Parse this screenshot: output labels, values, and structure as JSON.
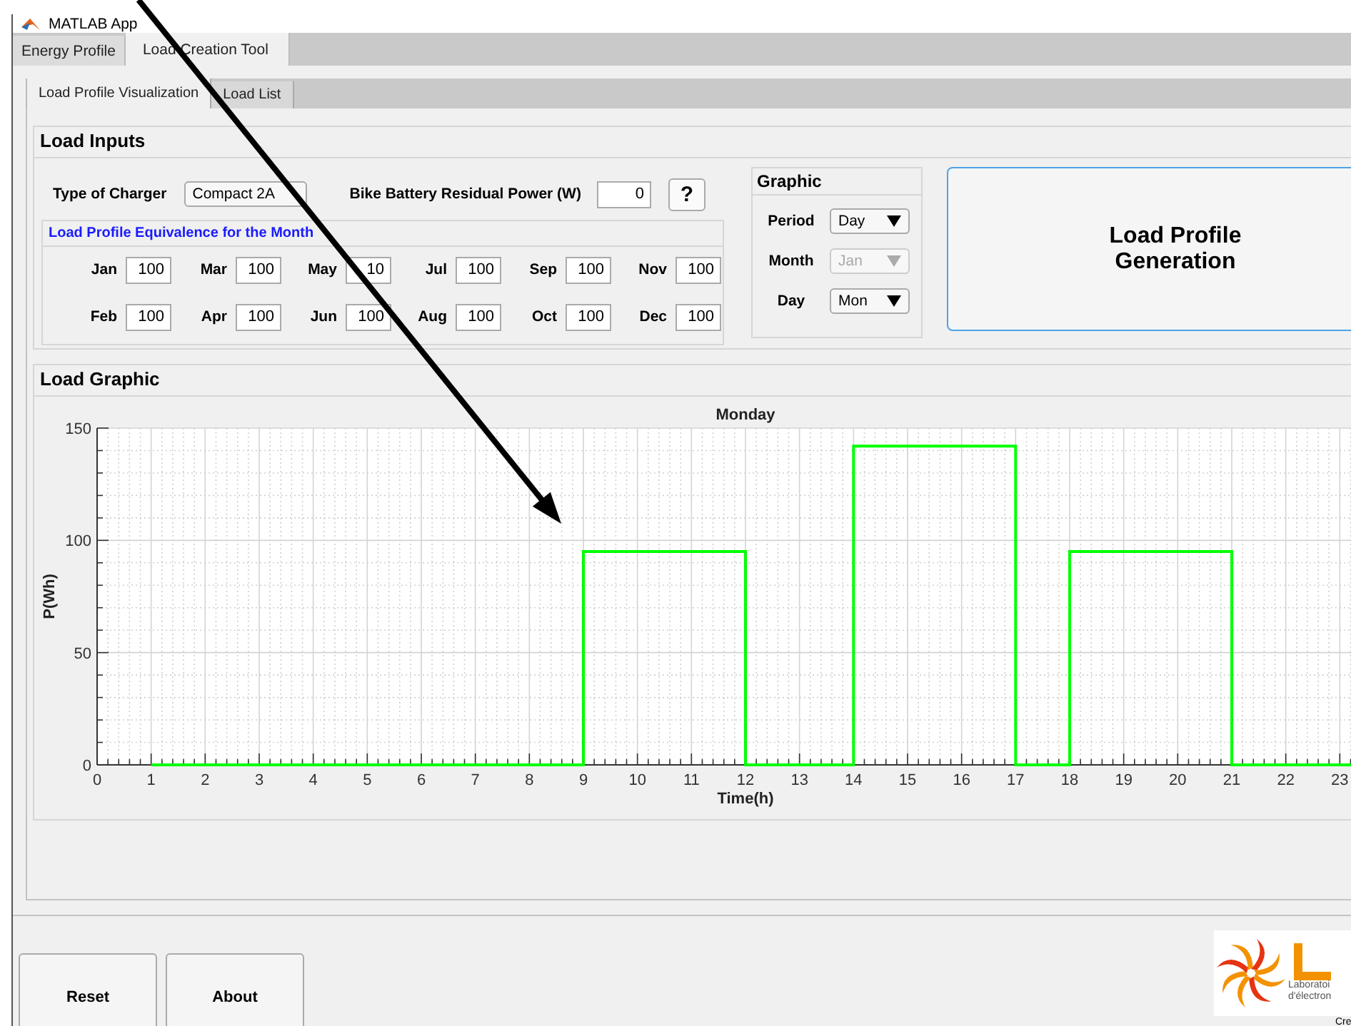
{
  "window": {
    "title": "MATLAB App"
  },
  "tabs": [
    {
      "label": "Energy Profile",
      "selected": false
    },
    {
      "label": "Load Creation Tool",
      "selected": true
    }
  ],
  "subtabs": [
    {
      "label": "Load Profile Visualization",
      "selected": true
    },
    {
      "label": "Load List",
      "selected": false
    }
  ],
  "load_inputs": {
    "title": "Load Inputs",
    "charger_label": "Type of Charger",
    "charger_value": "Compact 2A",
    "residual_label": "Bike Battery Residual Power (W)",
    "residual_value": "0",
    "help_button": "?",
    "equivalence": {
      "title": "Load Profile Equivalence for the Month",
      "months": [
        {
          "label": "Jan",
          "value": "100"
        },
        {
          "label": "Feb",
          "value": "100"
        },
        {
          "label": "Mar",
          "value": "100"
        },
        {
          "label": "Apr",
          "value": "100"
        },
        {
          "label": "May",
          "value": "10"
        },
        {
          "label": "Jun",
          "value": "100"
        },
        {
          "label": "Jul",
          "value": "100"
        },
        {
          "label": "Aug",
          "value": "100"
        },
        {
          "label": "Sep",
          "value": "100"
        },
        {
          "label": "Oct",
          "value": "100"
        },
        {
          "label": "Nov",
          "value": "100"
        },
        {
          "label": "Dec",
          "value": "100"
        }
      ]
    }
  },
  "graphic": {
    "title": "Graphic",
    "selectors": [
      {
        "label": "Period",
        "value": "Day",
        "disabled": false
      },
      {
        "label": "Month",
        "value": "Jan",
        "disabled": true
      },
      {
        "label": "Day",
        "value": "Mon",
        "disabled": false
      }
    ]
  },
  "generate_button": "Load Profile Generation",
  "load_graphic": {
    "title": "Load Graphic",
    "chart_data": {
      "type": "line",
      "title": "Monday",
      "xlabel": "Time(h)",
      "ylabel": "P(Wh)",
      "x": [
        1,
        9,
        9,
        12,
        12,
        14,
        14,
        17,
        17,
        18,
        18,
        21,
        21,
        24
      ],
      "series": [
        {
          "color": "#00ff00",
          "values": [
            0,
            0,
            95,
            95,
            0,
            0,
            142,
            142,
            0,
            0,
            95,
            95,
            0,
            0
          ]
        }
      ],
      "xlim": [
        0,
        24
      ],
      "ylim": [
        0,
        150
      ],
      "grid": true,
      "xticks": [
        0,
        1,
        2,
        3,
        4,
        5,
        6,
        7,
        8,
        9,
        10,
        11,
        12,
        13,
        14,
        15,
        16,
        17,
        18,
        19,
        20,
        21,
        22,
        23
      ],
      "yticks": [
        0,
        50,
        100,
        150
      ]
    }
  },
  "buttons": [
    "Reset",
    "About"
  ],
  "logo": {
    "lines": [
      "Laboratoi",
      "d'électron"
    ],
    "credit": "Cre"
  }
}
